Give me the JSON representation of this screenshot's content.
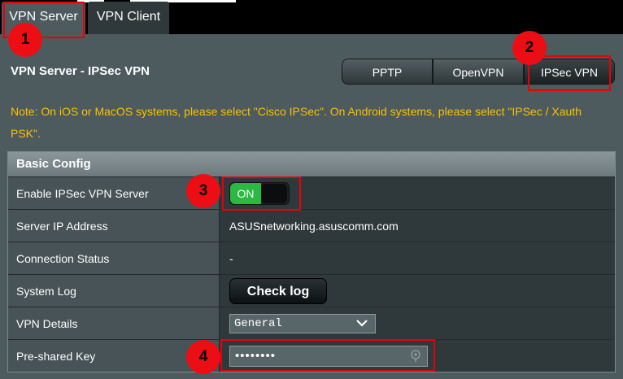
{
  "tabs": {
    "vpn_server": "VPN Server",
    "vpn_client": "VPN Client"
  },
  "page_title": "VPN Server - IPSec VPN",
  "vpn_type_buttons": [
    "PPTP",
    "OpenVPN",
    "IPSec VPN"
  ],
  "note": "Note: On iOS or MacOS systems, please select \"Cisco IPSec\". On Android systems, please select \"IPSec / Xauth PSK\".",
  "basic_config": {
    "header": "Basic Config",
    "rows": {
      "enable": {
        "label": "Enable IPSec VPN Server",
        "toggle": "ON"
      },
      "server_ip": {
        "label": "Server IP Address",
        "value": "ASUSnetworking.asuscomm.com"
      },
      "connection_status": {
        "label": "Connection Status",
        "value": "-"
      },
      "system_log": {
        "label": "System Log",
        "button": "Check log"
      },
      "vpn_details": {
        "label": "VPN Details",
        "selected": "General"
      },
      "psk": {
        "label": "Pre-shared Key",
        "value": "••••••••"
      }
    }
  },
  "annotations": [
    "1",
    "2",
    "3",
    "4"
  ],
  "colors": {
    "note": "#ffc000",
    "toggle_on": "#2bb843",
    "annotation_red": "#e8000b"
  },
  "icons": {
    "select_arrow": "chevron-down-icon",
    "psk_reveal": "key-icon"
  }
}
